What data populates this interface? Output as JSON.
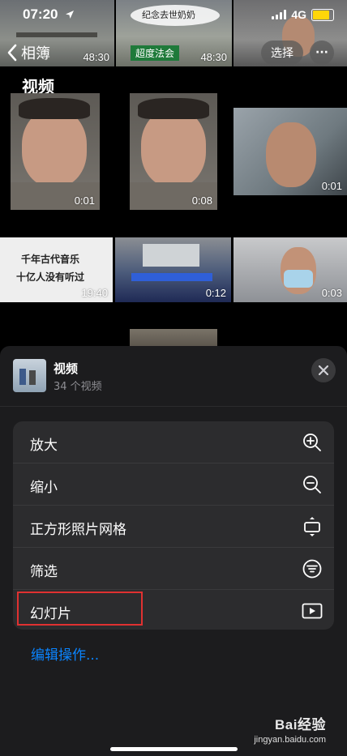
{
  "status_bar": {
    "time": "07:20",
    "network": "4G"
  },
  "nav": {
    "back_label": "相簿",
    "select_label": "选择",
    "more_label": "···"
  },
  "section_title": "视频",
  "top_strip": [
    {
      "duration": "48:30"
    },
    {
      "duration": "48:30",
      "caption_top": "纪念去世奶奶",
      "caption_sub": "超度法会"
    },
    {
      "duration": ""
    }
  ],
  "grid": [
    {
      "duration": "0:01"
    },
    {
      "duration": "0:08"
    },
    {
      "duration": "0:01"
    },
    {
      "duration": "19:40",
      "line1": "千年古代音乐",
      "line2": "十亿人没有听过"
    },
    {
      "duration": "0:12"
    },
    {
      "duration": "0:03"
    }
  ],
  "sheet": {
    "title": "视频",
    "subtitle": "34 个视频",
    "menu": [
      {
        "label": "放大",
        "icon": "zoom-in-icon"
      },
      {
        "label": "缩小",
        "icon": "zoom-out-icon"
      },
      {
        "label": "正方形照片网格",
        "icon": "aspect-toggle-icon"
      },
      {
        "label": "筛选",
        "icon": "filter-icon"
      },
      {
        "label": "幻灯片",
        "icon": "slideshow-play-icon"
      }
    ],
    "edit_actions": "编辑操作..."
  },
  "watermark": {
    "logo": "Bai经验",
    "url": "jingyan.baidu.com"
  },
  "colors": {
    "accent": "#0a84ff",
    "highlight": "#e03131",
    "sheet_bg": "#1c1c1e",
    "menu_bg": "#2c2c2e",
    "battery": "#ffd60a"
  }
}
